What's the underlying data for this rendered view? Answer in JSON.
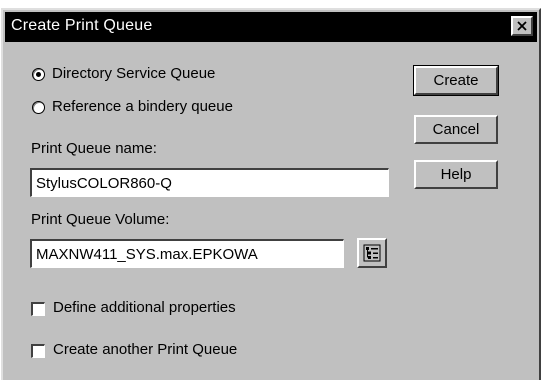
{
  "window": {
    "title": "Create Print Queue",
    "close_icon": "close-icon"
  },
  "options": {
    "directory_service": {
      "label": "Directory Service Queue",
      "selected": true
    },
    "bindery_queue": {
      "label": "Reference a bindery queue",
      "selected": false
    }
  },
  "queue_name": {
    "label": "Print Queue name:",
    "value": "StylusCOLOR860-Q"
  },
  "queue_volume": {
    "label": "Print Queue Volume:",
    "value": "MAXNW411_SYS.max.EPKOWA",
    "browse_icon": "directory-browse-icon"
  },
  "checkboxes": {
    "define_properties": {
      "label": "Define additional properties",
      "checked": false
    },
    "create_another": {
      "label": "Create another Print Queue",
      "checked": false
    }
  },
  "buttons": {
    "create": "Create",
    "cancel": "Cancel",
    "help": "Help"
  }
}
